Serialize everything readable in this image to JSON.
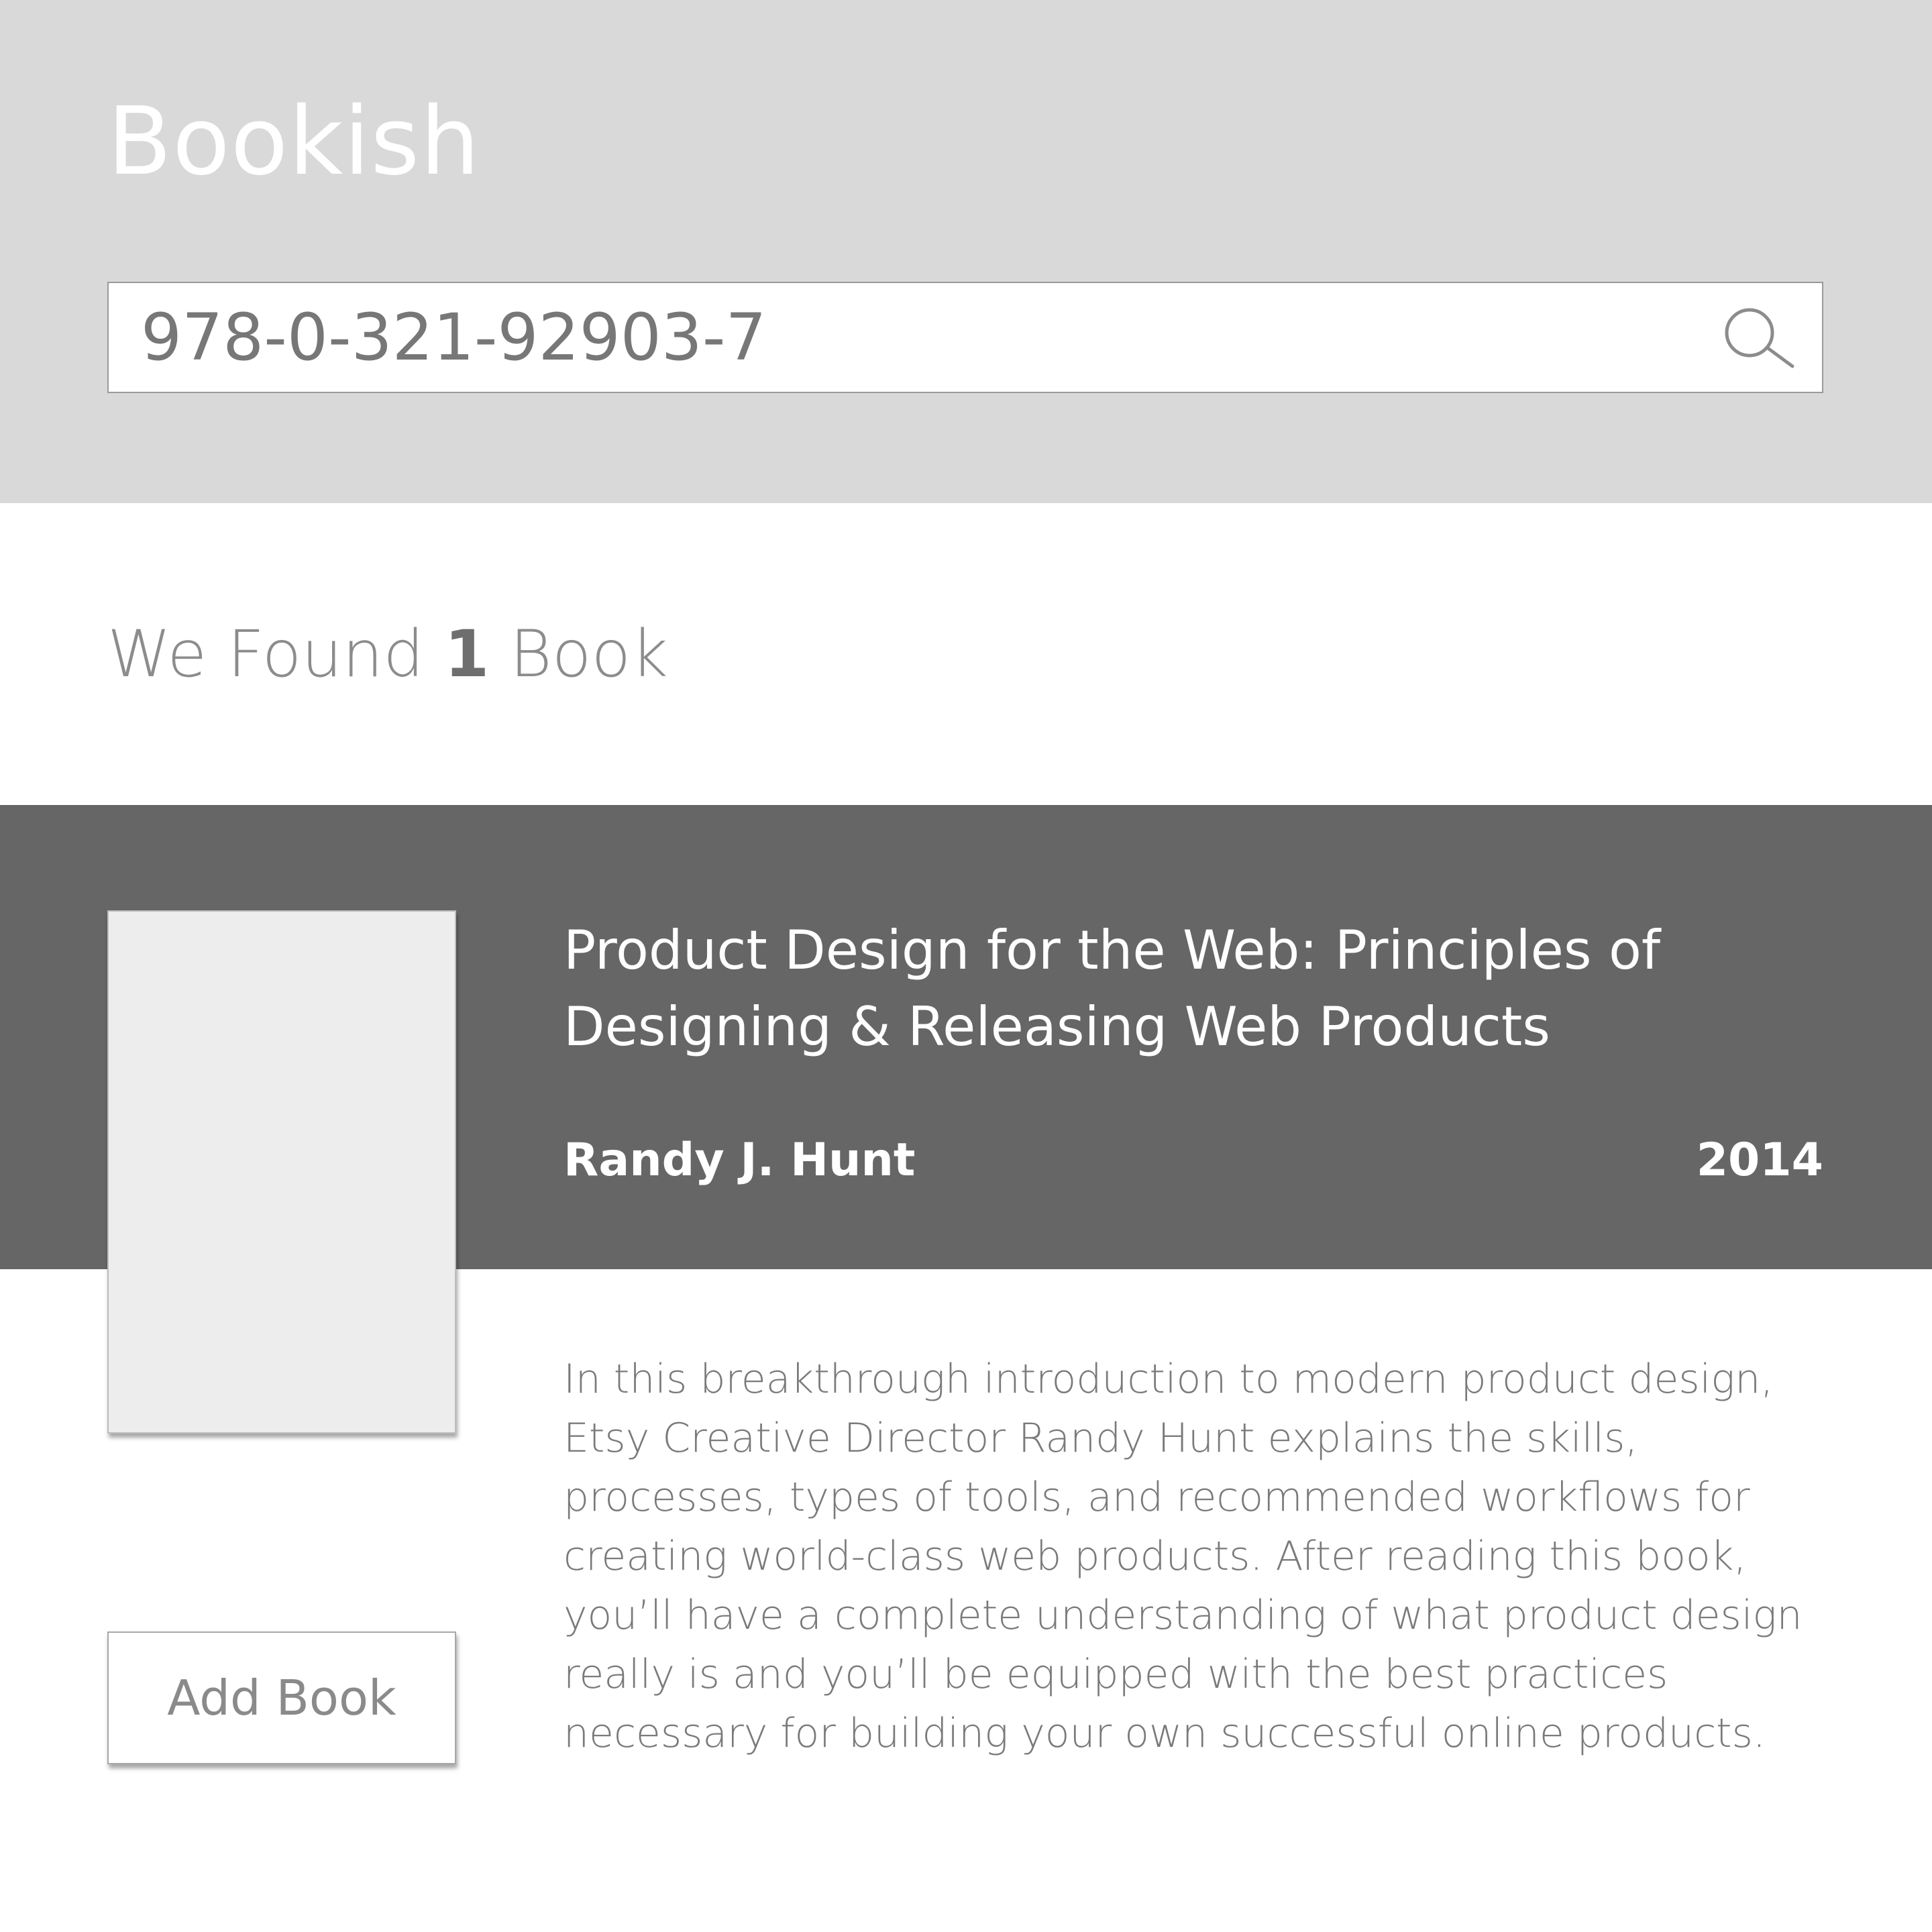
{
  "app": {
    "title": "Bookish"
  },
  "search": {
    "value": "978-0-321-92903-7",
    "icon": "search-icon"
  },
  "results": {
    "prefix": "We Found ",
    "count": "1",
    "suffix": " Book"
  },
  "book": {
    "title": "Product Design for the Web: Principles of Designing & Releasing Web Products",
    "author": "Randy J. Hunt",
    "year": "2014",
    "description": "In this breakthrough introduction to modern product design, Etsy Creative Director Randy Hunt explains the skills, processes, types of tools, and recommended workflows for creating world-class web products. After reading this book, you’ll have a complete understanding of what product design really is and you’ll be equipped with the best practices necessary for building your own successful online products.",
    "add_button_label": "Add Book"
  },
  "colors": {
    "header_bg": "#d9d9d9",
    "result_band_bg": "#666666",
    "cover_placeholder": "#ededed"
  }
}
